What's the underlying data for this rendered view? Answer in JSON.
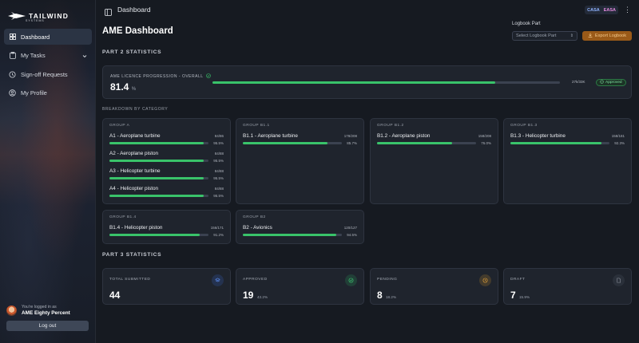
{
  "brand": {
    "name": "TAILWIND",
    "sub": "SYSTEMS"
  },
  "sidebar": {
    "items": [
      {
        "label": "Dashboard",
        "icon": "grid-icon",
        "active": true
      },
      {
        "label": "My Tasks",
        "icon": "clipboard-icon",
        "active": false
      },
      {
        "label": "Sign-off Requests",
        "icon": "history-icon",
        "active": false
      },
      {
        "label": "My Profile",
        "icon": "user-icon",
        "active": false
      }
    ],
    "user": {
      "logged_in_as": "You're logged in as",
      "name": "AME Eighty Percent"
    },
    "logout_label": "Log out"
  },
  "topbar": {
    "title": "Dashboard",
    "badge_left": "CASA",
    "badge_right": "EASA"
  },
  "page": {
    "title": "AME Dashboard",
    "logbook_label": "Logbook Part",
    "logbook_placeholder": "Select Logbook Part",
    "export_label": "Export Logbook"
  },
  "part2": {
    "heading": "PART 2 STATISTICS",
    "overall": {
      "label": "AME LICENCE PROGRESSION - OVERALL",
      "value": "81.4",
      "unit": "%",
      "progress": 0.814,
      "count": "27k/33K",
      "status": "Approved"
    },
    "breakdown_label": "BREAKDOWN BY CATEGORY",
    "groups": [
      {
        "title": "GROUP A",
        "items": [
          {
            "name": "A1 - Aeroplane turbine",
            "count": "84/86",
            "pct": "95.5%",
            "progress": 0.955
          },
          {
            "name": "A2 - Aeroplane piston",
            "count": "84/88",
            "pct": "95.5%",
            "progress": 0.955
          },
          {
            "name": "A3 - Helicopter turbine",
            "count": "84/88",
            "pct": "95.5%",
            "progress": 0.955
          },
          {
            "name": "A4 - Helicopter piston",
            "count": "84/88",
            "pct": "95.5%",
            "progress": 0.955
          }
        ]
      },
      {
        "title": "GROUP B1.1",
        "items": [
          {
            "name": "B1.1 - Aeroplane turbine",
            "count": "178/208",
            "pct": "85.7%",
            "progress": 0.857
          }
        ]
      },
      {
        "title": "GROUP B1.2",
        "items": [
          {
            "name": "B1.2 - Aeroplane piston",
            "count": "158/208",
            "pct": "76.0%",
            "progress": 0.76
          }
        ]
      },
      {
        "title": "GROUP B1.3",
        "items": [
          {
            "name": "B1.3 - Helicopter turbine",
            "count": "158/181",
            "pct": "92.3%",
            "progress": 0.923
          }
        ]
      },
      {
        "title": "GROUP B1.4",
        "items": [
          {
            "name": "B1.4 - Helicopter piston",
            "count": "156/171",
            "pct": "91.2%",
            "progress": 0.912
          }
        ]
      },
      {
        "title": "GROUP B2",
        "items": [
          {
            "name": "B2 - Avionics",
            "count": "120/127",
            "pct": "94.5%",
            "progress": 0.945
          }
        ]
      }
    ]
  },
  "part3": {
    "heading": "PART 3 STATISTICS",
    "stats": [
      {
        "label": "TOTAL SUBMITTED",
        "value": "44",
        "pct": "",
        "icon": "layers-icon",
        "color": "#3b6fd8"
      },
      {
        "label": "APPROVED",
        "value": "19",
        "pct": "43.2%",
        "icon": "check-circle-icon",
        "color": "#2fae5f"
      },
      {
        "label": "PENDING",
        "value": "8",
        "pct": "18.2%",
        "icon": "clock-icon",
        "color": "#d99a2b"
      },
      {
        "label": "DRAFT",
        "value": "7",
        "pct": "15.9%",
        "icon": "document-icon",
        "color": "#5b6270"
      }
    ]
  }
}
